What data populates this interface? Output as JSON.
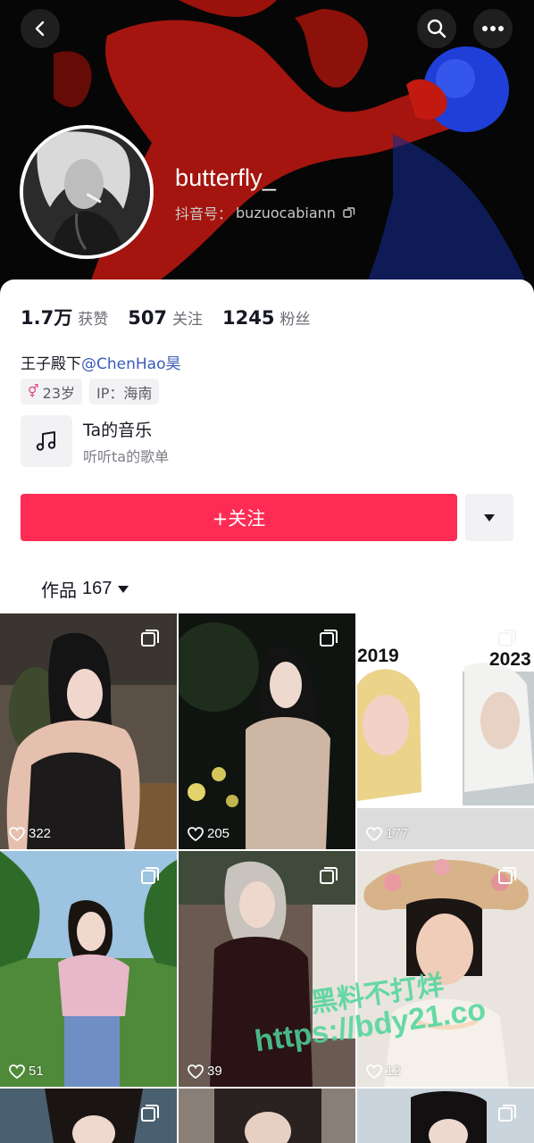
{
  "profile": {
    "username": "butterfly_",
    "douyin_id_label": "抖音号：",
    "douyin_id": "buzuocabiann",
    "stats": [
      {
        "value": "1.7万",
        "label": "获赞"
      },
      {
        "value": "507",
        "label": "关注"
      },
      {
        "value": "1245",
        "label": "粉丝"
      }
    ],
    "bio_prefix": "王子殿下",
    "bio_mention": "@ChenHao昊",
    "tags": {
      "gender_symbol": "⚥",
      "age": "23岁",
      "ip": "IP：海南"
    },
    "music": {
      "title": "Ta的音乐",
      "subtitle": "听听ta的歌单"
    },
    "follow_label": "+关注",
    "works_tab": {
      "label": "作品",
      "count": "167"
    }
  },
  "colors": {
    "accent": "#fe2c55",
    "mention": "#3a5bb8",
    "watermark": "#4fd59a"
  },
  "posts": [
    {
      "likes": "322"
    },
    {
      "likes": "205"
    },
    {
      "likes": "177",
      "years": [
        "2019",
        "2023"
      ]
    },
    {
      "likes": "51"
    },
    {
      "likes": "39"
    },
    {
      "likes": "12"
    }
  ],
  "watermark": {
    "line1": "黑料不打烊",
    "line2": "https://bdy21.co"
  }
}
